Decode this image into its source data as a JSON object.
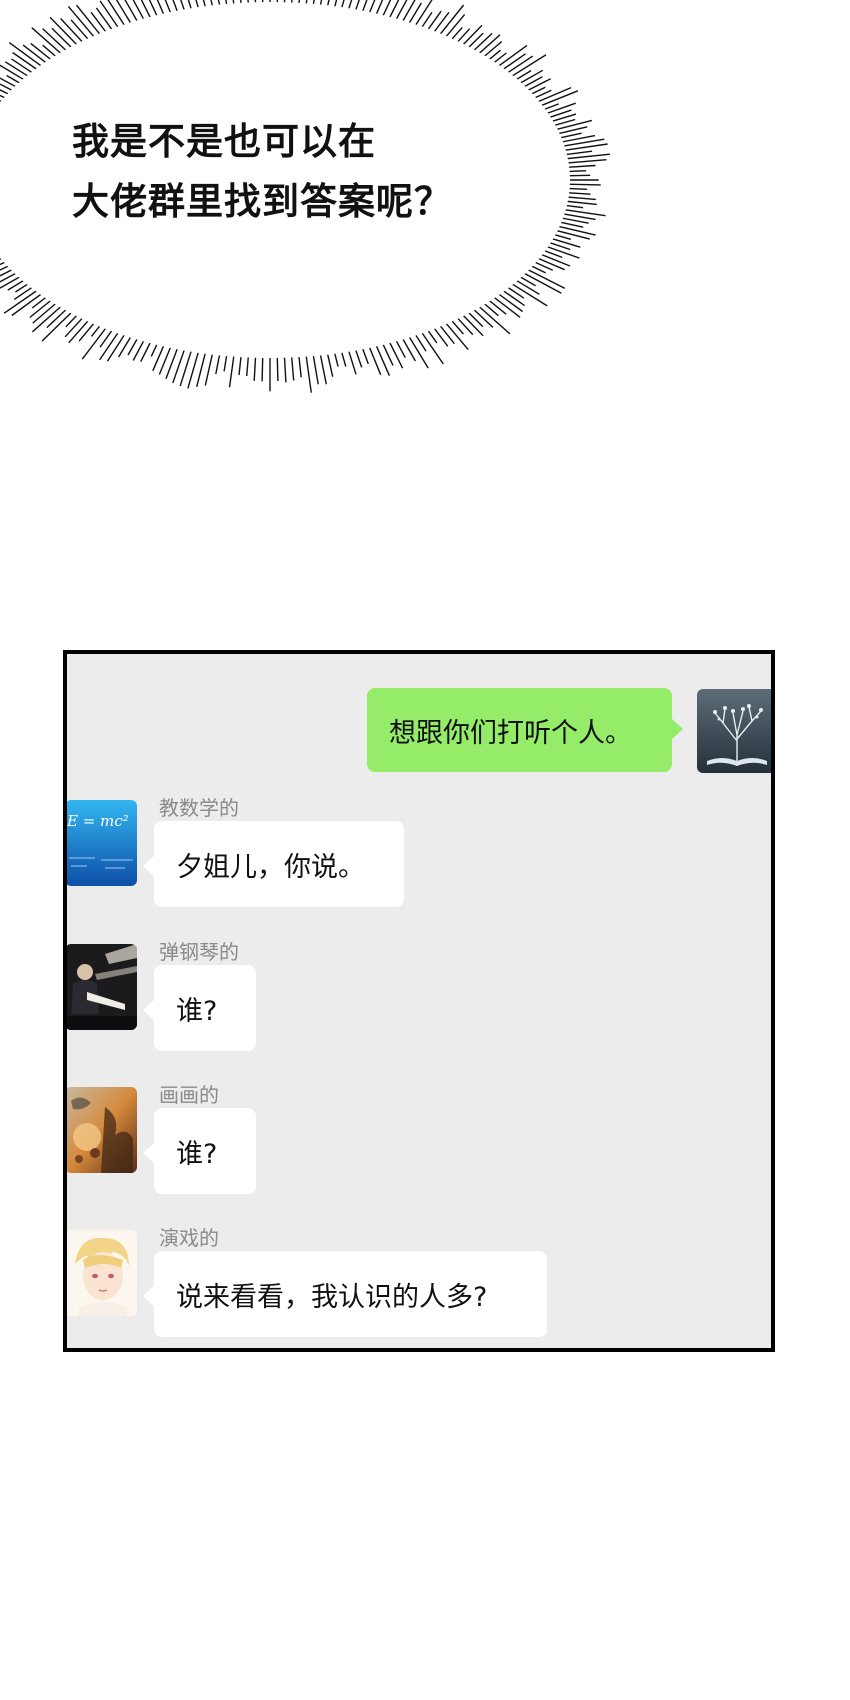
{
  "speech_bubble": {
    "line1": "我是不是也可以在",
    "line2": "大佬群里找到答案呢？"
  },
  "chat": {
    "colors": {
      "panel_bg": "#ececec",
      "self_bubble": "#95ec69",
      "other_bubble": "#ffffff",
      "name": "#8a8a8a"
    },
    "self_message": {
      "text": "想跟你们打听个人。",
      "avatar_icon": "tree-on-book-avatar-icon"
    },
    "messages": [
      {
        "sender": "教数学的",
        "text": "夕姐儿，你说。",
        "avatar_icon": "math-formula-avatar-icon",
        "avatar_text": "E = mc²"
      },
      {
        "sender": "弹钢琴的",
        "text": "谁?",
        "avatar_icon": "pianist-avatar-icon"
      },
      {
        "sender": "画画的",
        "text": "谁?",
        "avatar_icon": "painting-avatar-icon"
      },
      {
        "sender": "演戏的",
        "text": "说来看看，我认识的人多?",
        "avatar_icon": "actor-avatar-icon"
      }
    ]
  }
}
